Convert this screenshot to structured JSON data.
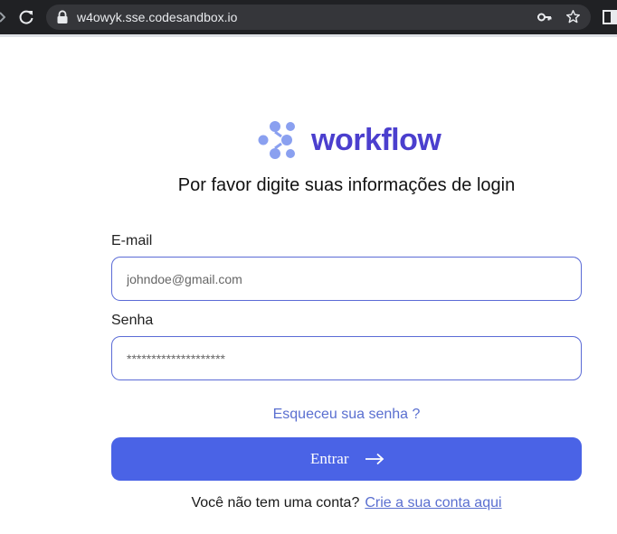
{
  "browser": {
    "url": "w4owyk.sse.codesandbox.io",
    "icons": [
      "forward-icon",
      "reload-icon",
      "lock-icon",
      "key-icon",
      "star-icon",
      "side-panel-icon"
    ]
  },
  "brand": {
    "name": "workflow",
    "color": "#4b3fce",
    "mark_color": "#8aa0f0"
  },
  "page": {
    "subtitle": "Por favor digite suas informações de login"
  },
  "form": {
    "email_label": "E-mail",
    "email_placeholder": "johndoe@gmail.com",
    "password_label": "Senha",
    "password_placeholder": "********************",
    "forgot_link": "Esqueceu sua senha ?",
    "submit_label": "Entrar",
    "submit_color": "#4a63e6"
  },
  "signup": {
    "prompt": "Você não tem uma conta?",
    "link": "Crie a sua conta aqui"
  }
}
